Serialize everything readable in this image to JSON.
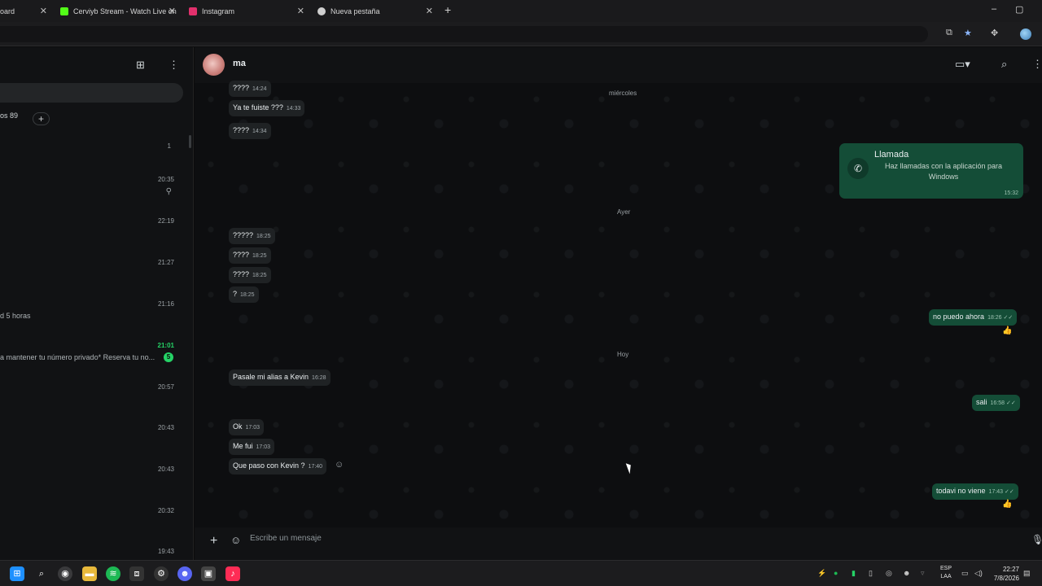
{
  "browser": {
    "tabs": [
      {
        "title": "oard",
        "icon_color": "#2b2b2b"
      },
      {
        "title": "Cerviyb Stream - Watch Live on",
        "icon_color": "#53fc18"
      },
      {
        "title": "Instagram",
        "icon_color": "#e1306c"
      },
      {
        "title": "Nueva pestaña",
        "icon_color": "#cfcfcf"
      }
    ],
    "new_tab": "+",
    "window_controls": [
      "–",
      "▢"
    ]
  },
  "sidebar": {
    "chip_text": "os 89",
    "unread_top": "1",
    "times": [
      "20:35",
      "22:19",
      "21:27",
      "21:16",
      "21:01",
      "20:57",
      "20:43",
      "20:43",
      "20:32",
      "19:43"
    ],
    "snippets": [
      {
        "text": "d 5 horas"
      },
      {
        "text": "a mantener tu número privado* Reserva tu no...",
        "badge": "5"
      }
    ]
  },
  "chat": {
    "contact_name": "ma",
    "day_labels": {
      "wed": "miércoles",
      "yesterday": "Ayer",
      "today": "Hoy"
    },
    "incoming": [
      {
        "text": "????",
        "time": "14:24"
      },
      {
        "text": "Ya te fuiste ???",
        "time": "14:33"
      },
      {
        "text": "????",
        "time": "14:34"
      },
      {
        "text": "?????",
        "time": "18:25"
      },
      {
        "text": "????",
        "time": "18:25"
      },
      {
        "text": "????",
        "time": "18:25"
      },
      {
        "text": "?",
        "time": "18:25"
      },
      {
        "text": "Pasale mi alias a Kevin",
        "time": "16:28"
      },
      {
        "text": "Ok",
        "time": "17:03"
      },
      {
        "text": "Me fui",
        "time": "17:03"
      },
      {
        "text": "Que paso con Kevin ?",
        "time": "17:40"
      }
    ],
    "outgoing": [
      {
        "text": "no puedo ahora",
        "time": "18:26 ✓✓"
      },
      {
        "text": "sali",
        "time": "16:58 ✓✓"
      },
      {
        "text": "todavi no viene",
        "time": "17:43 ✓✓"
      }
    ],
    "call_card": {
      "title": "Llamada",
      "subtitle": "Haz llamadas con la aplicación para Windows",
      "time": "15:32"
    },
    "composer_placeholder": "Escribe un mensaje"
  },
  "taskbar": {
    "lang": "ESP",
    "lang2": "LAA",
    "time": "22:27",
    "date": "7/8/2026"
  },
  "colors": {
    "accent_green": "#25d366",
    "outgoing_bubble": "#144d37",
    "incoming_bubble": "#1f2224"
  }
}
